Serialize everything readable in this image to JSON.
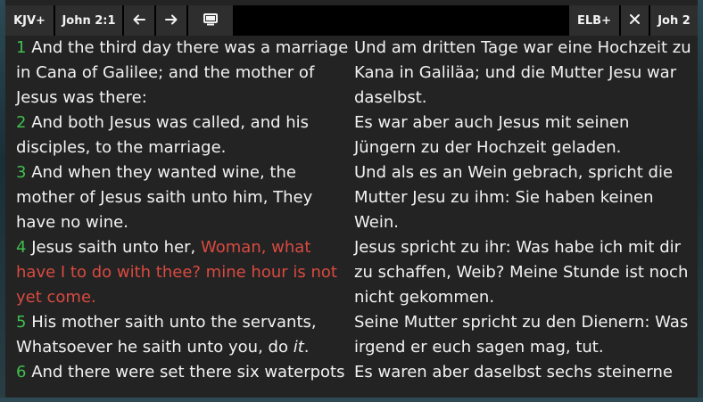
{
  "toolbar": {
    "left_version": "KJV+",
    "reference": "John 2:1",
    "back_icon": "arrow-left-icon",
    "forward_icon": "arrow-right-icon",
    "display_icon": "monitor-icon",
    "right_version": "ELB+",
    "close_icon": "close-icon",
    "right_reference": "Joh 2"
  },
  "colors": {
    "verse_number": "#3fbf4f",
    "words_of_jesus": "#d94a40",
    "text": "#f2f2f2",
    "background": "#232323"
  },
  "left": {
    "verses": [
      {
        "num": "1",
        "text": "And the third day there was a marriage in Cana of Galilee; and the mother of Jesus was there:"
      },
      {
        "num": "2",
        "text": "And both Jesus was called, and his disciples, to the marriage."
      },
      {
        "num": "3",
        "text": "And when they wanted wine, the mother of Jesus saith unto him, They have no wine."
      },
      {
        "num": "4",
        "text": "Jesus saith unto her,",
        "red": "Woman, what have I to do with thee? mine hour is not yet come."
      },
      {
        "num": "5",
        "text": "His mother saith unto the servants, Whatsoever he saith unto you, do",
        "italic": "it",
        "after": "."
      },
      {
        "num": "6",
        "text": "And there were set there six waterpots"
      }
    ]
  },
  "right": {
    "verses": [
      "Und am dritten Tage war eine Hochzeit zu Kana in Galiläa; und die Mutter Jesu war daselbst.",
      "Es war aber auch Jesus mit seinen Jüngern zu der Hochzeit geladen.",
      "Und als es an Wein gebrach, spricht die Mutter Jesu zu ihm: Sie haben keinen Wein.",
      "Jesus spricht zu ihr: Was habe ich mit dir zu schaffen, Weib? Meine Stunde ist noch nicht gekommen.",
      "Seine Mutter spricht zu den Dienern: Was irgend er euch sagen mag, tut.",
      "Es waren aber daselbst sechs steinerne"
    ]
  }
}
